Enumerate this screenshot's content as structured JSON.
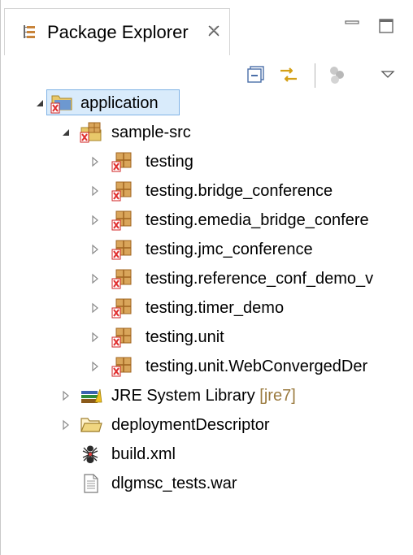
{
  "view": {
    "title": "Package Explorer",
    "close_glyph": "☒",
    "icons": {
      "tab": "package-explorer-icon",
      "minimize": "minimize-icon",
      "maximize": "maximize-icon",
      "collapse_all": "collapse-all-icon",
      "link_with_editor": "link-with-editor-icon",
      "focus": "focus-on-active-task-icon",
      "view_menu": "view-menu-chevron-icon"
    }
  },
  "tree": {
    "project": {
      "label": "application",
      "icon": "java-project-error-icon",
      "expanded": true,
      "selected": true
    },
    "source_folder": {
      "label": "sample-src",
      "icon": "source-folder-error-icon",
      "expanded": true
    },
    "packages": [
      {
        "label": "testing",
        "icon": "package-error-icon"
      },
      {
        "label": "testing.bridge_conference",
        "icon": "package-error-icon"
      },
      {
        "label": "testing.emedia_bridge_confere",
        "icon": "package-error-icon"
      },
      {
        "label": "testing.jmc_conference",
        "icon": "package-error-icon"
      },
      {
        "label": "testing.reference_conf_demo_v",
        "icon": "package-error-icon"
      },
      {
        "label": "testing.timer_demo",
        "icon": "package-error-icon"
      },
      {
        "label": "testing.unit",
        "icon": "package-error-icon"
      },
      {
        "label": "testing.unit.WebConvergedDer",
        "icon": "package-error-icon"
      }
    ],
    "library": {
      "label": "JRE System Library",
      "decoration": "[jre7]",
      "icon": "library-icon"
    },
    "folder": {
      "label": "deploymentDescriptor",
      "icon": "folder-icon"
    },
    "files": [
      {
        "label": "build.xml",
        "icon": "ant-file-icon"
      },
      {
        "label": "dlgmsc_tests.war",
        "icon": "file-icon"
      }
    ]
  },
  "colors": {
    "selection": "#d9ebfb",
    "selection_border": "#7fb2e5",
    "decoration": "#9b7b40",
    "error": "#e03030",
    "package": "#c8843a",
    "folder": "#e8c86a"
  }
}
